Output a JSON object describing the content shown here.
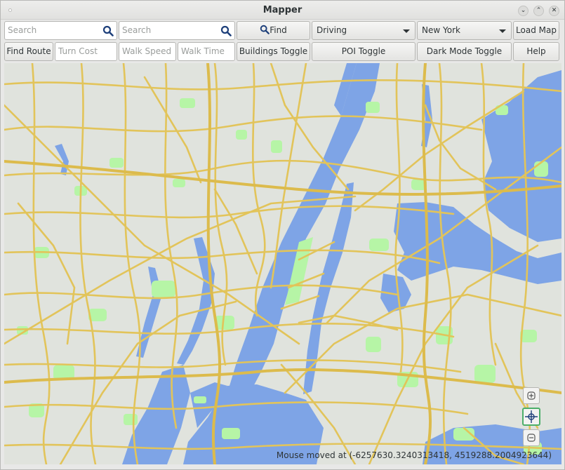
{
  "window": {
    "title": "Mapper"
  },
  "toolbar": {
    "search1_placeholder": "Search",
    "search2_placeholder": "Search",
    "find_label": "Find",
    "mode_value": "Driving",
    "city_value": "New York",
    "load_map_label": "Load Map",
    "find_route_label": "Find Route",
    "turn_cost_placeholder": "Turn Cost",
    "walk_speed_placeholder": "Walk Speed",
    "walk_time_placeholder": "Walk Time",
    "buildings_toggle_label": "Buildings Toggle",
    "poi_toggle_label": "POI Toggle",
    "dark_mode_toggle_label": "Dark Mode Toggle",
    "help_label": "Help"
  },
  "map": {
    "colors": {
      "water": "#7ea4e6",
      "land": "#e0e3dd",
      "park": "#b6f5a6",
      "road": "#e2c45a"
    },
    "controls": {
      "zoom_in_icon": "zoom-in-icon",
      "pan_icon": "pan-crosshair-icon",
      "zoom_out_icon": "zoom-out-icon"
    }
  },
  "status": {
    "mouse_text": "Mouse moved at (-6257630.3240313418, 4519288.2004923644)"
  }
}
